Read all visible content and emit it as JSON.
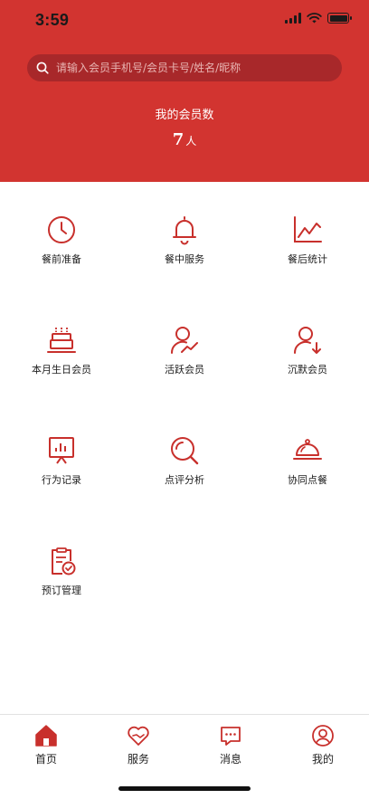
{
  "status_bar": {
    "time": "3:59",
    "signal_bars": 4,
    "battery_level": 1.0
  },
  "search": {
    "placeholder": "请输入会员手机号/会员卡号/姓名/昵称",
    "value": ""
  },
  "summary": {
    "title": "我的会员数",
    "count": "7",
    "unit": "人"
  },
  "grid": {
    "items": [
      {
        "label": "餐前准备",
        "icon": "clock-icon"
      },
      {
        "label": "餐中服务",
        "icon": "bell-icon"
      },
      {
        "label": "餐后统计",
        "icon": "line-chart-icon"
      },
      {
        "label": "本月生日会员",
        "icon": "birthday-cake-icon"
      },
      {
        "label": "活跃会员",
        "icon": "active-user-icon"
      },
      {
        "label": "沉默会员",
        "icon": "silent-user-icon"
      },
      {
        "label": "行为记录",
        "icon": "presentation-board-icon"
      },
      {
        "label": "点评分析",
        "icon": "magnifier-icon"
      },
      {
        "label": "协同点餐",
        "icon": "dish-cover-icon"
      },
      {
        "label": "预订管理",
        "icon": "clipboard-check-icon"
      }
    ]
  },
  "tabbar": {
    "items": [
      {
        "label": "首页",
        "icon": "home-icon",
        "active": true
      },
      {
        "label": "服务",
        "icon": "heart-hand-icon",
        "active": false
      },
      {
        "label": "消息",
        "icon": "message-icon",
        "active": false
      },
      {
        "label": "我的",
        "icon": "user-circle-icon",
        "active": false
      }
    ]
  },
  "colors": {
    "brand_red": "#d23430",
    "search_bg": "#a8282a",
    "icon_red": "#c8302c"
  }
}
